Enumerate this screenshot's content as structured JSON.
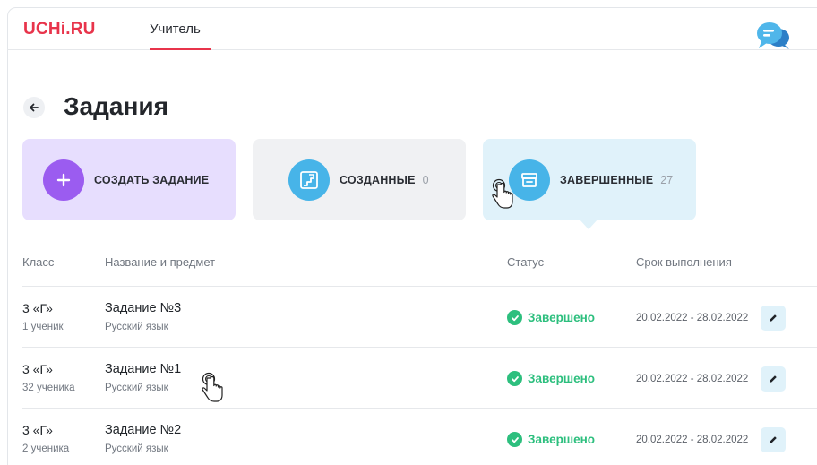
{
  "header": {
    "logo": "UCHi.RU",
    "tab": "Учитель"
  },
  "page": {
    "title": "Задания"
  },
  "cards": {
    "create": {
      "label": "СОЗДАТЬ ЗАДАНИЕ"
    },
    "created": {
      "label": "СОЗДАННЫЕ",
      "count": "0"
    },
    "done": {
      "label": "ЗАВЕРШЕННЫЕ",
      "count": "27"
    }
  },
  "table": {
    "headers": {
      "class": "Класс",
      "name": "Название и предмет",
      "status": "Статус",
      "deadline": "Срок выполнения"
    },
    "rows": [
      {
        "class": "3 «Г»",
        "students": "1 ученик",
        "name": "Задание №3",
        "subject": "Русский язык",
        "status": "Завершено",
        "dates": "20.02.2022 - 28.02.2022"
      },
      {
        "class": "3 «Г»",
        "students": "32 ученика",
        "name": "Задание №1",
        "subject": "Русский язык",
        "status": "Завершено",
        "dates": "20.02.2022 - 28.02.2022"
      },
      {
        "class": "3 «Г»",
        "students": "2 ученика",
        "name": "Задание №2",
        "subject": "Русский язык",
        "status": "Завершено",
        "dates": "20.02.2022 - 28.02.2022"
      }
    ]
  },
  "colors": {
    "brand": "#e8344b",
    "purple": "#9b5cf0",
    "blue": "#47b4e8",
    "success": "#2dbf7e"
  }
}
